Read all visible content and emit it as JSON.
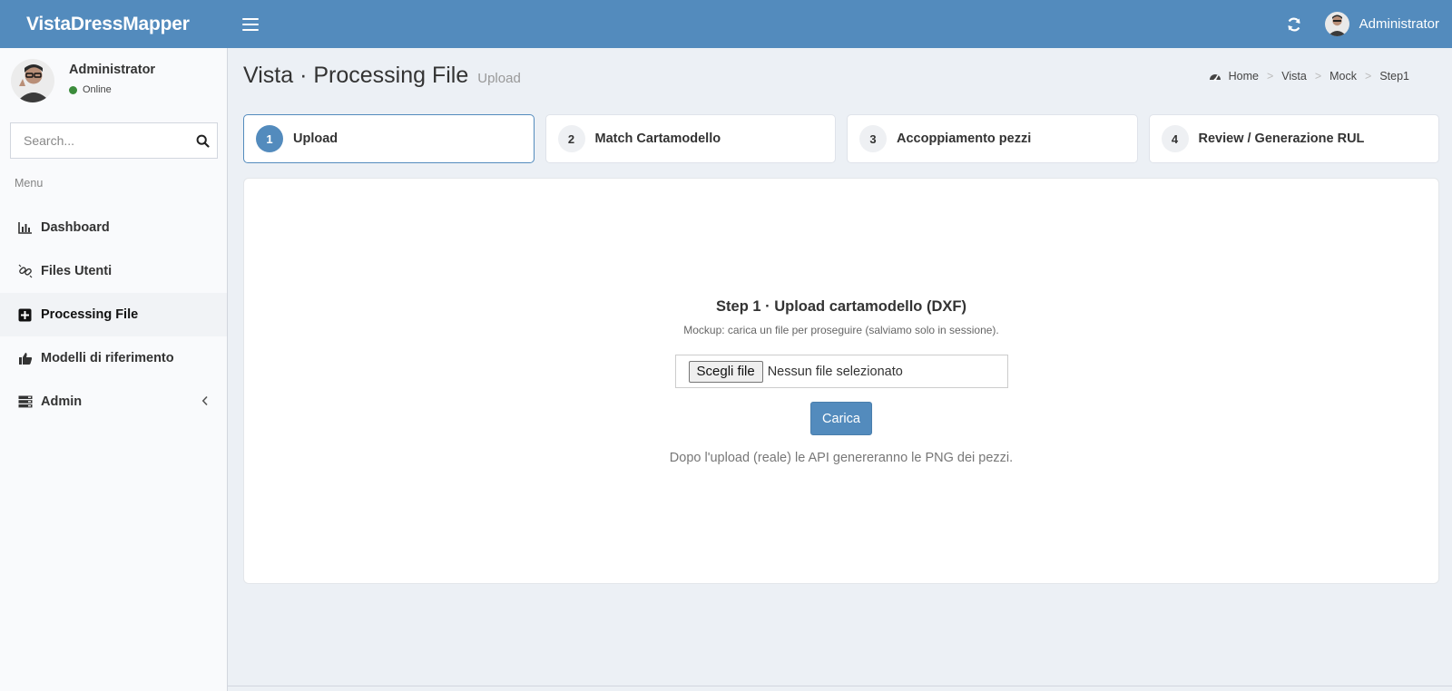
{
  "header": {
    "brand": "VistaDressMapper",
    "user_name": "Administrator",
    "menu_icon": "hamburger-icon",
    "refresh_icon": "refresh-icon",
    "bg_color": "#538bbd"
  },
  "sidebar": {
    "user": {
      "name": "Administrator",
      "status": "Online",
      "status_color": "#3c8c3c"
    },
    "search": {
      "placeholder": "Search...",
      "icon": "search-icon"
    },
    "menu_header": "Menu",
    "items": [
      {
        "label": "Dashboard",
        "icon": "bar-chart-icon",
        "active": false
      },
      {
        "label": "Files Utenti",
        "icon": "chain-link-icon",
        "active": false
      },
      {
        "label": "Processing File",
        "icon": "plus-square-icon",
        "active": true
      },
      {
        "label": "Modelli di riferimento",
        "icon": "thumbs-up-icon",
        "active": false
      },
      {
        "label": "Admin",
        "icon": "server-icon",
        "active": false,
        "expandable": true
      }
    ]
  },
  "page": {
    "title": "Vista · Processing File",
    "subtitle": "Upload",
    "breadcrumb": [
      "Home",
      "Vista",
      "Mock",
      "Step1"
    ]
  },
  "steps": [
    {
      "number": "1",
      "label": "Upload",
      "active": true
    },
    {
      "number": "2",
      "label": "Match Cartamodello",
      "active": false
    },
    {
      "number": "3",
      "label": "Accoppiamento pezzi",
      "active": false
    },
    {
      "number": "4",
      "label": "Review / Generazione RUL",
      "active": false
    }
  ],
  "upload": {
    "heading": "Step 1 · Upload cartamodello (DXF)",
    "subtitle": "Mockup: carica un file per proseguire (salviamo solo in sessione).",
    "file_button": "Scegli file",
    "file_status": "Nessun file selezionato",
    "submit_label": "Carica",
    "note": "Dopo l'upload (reale) le API genereranno le PNG dei pezzi."
  }
}
